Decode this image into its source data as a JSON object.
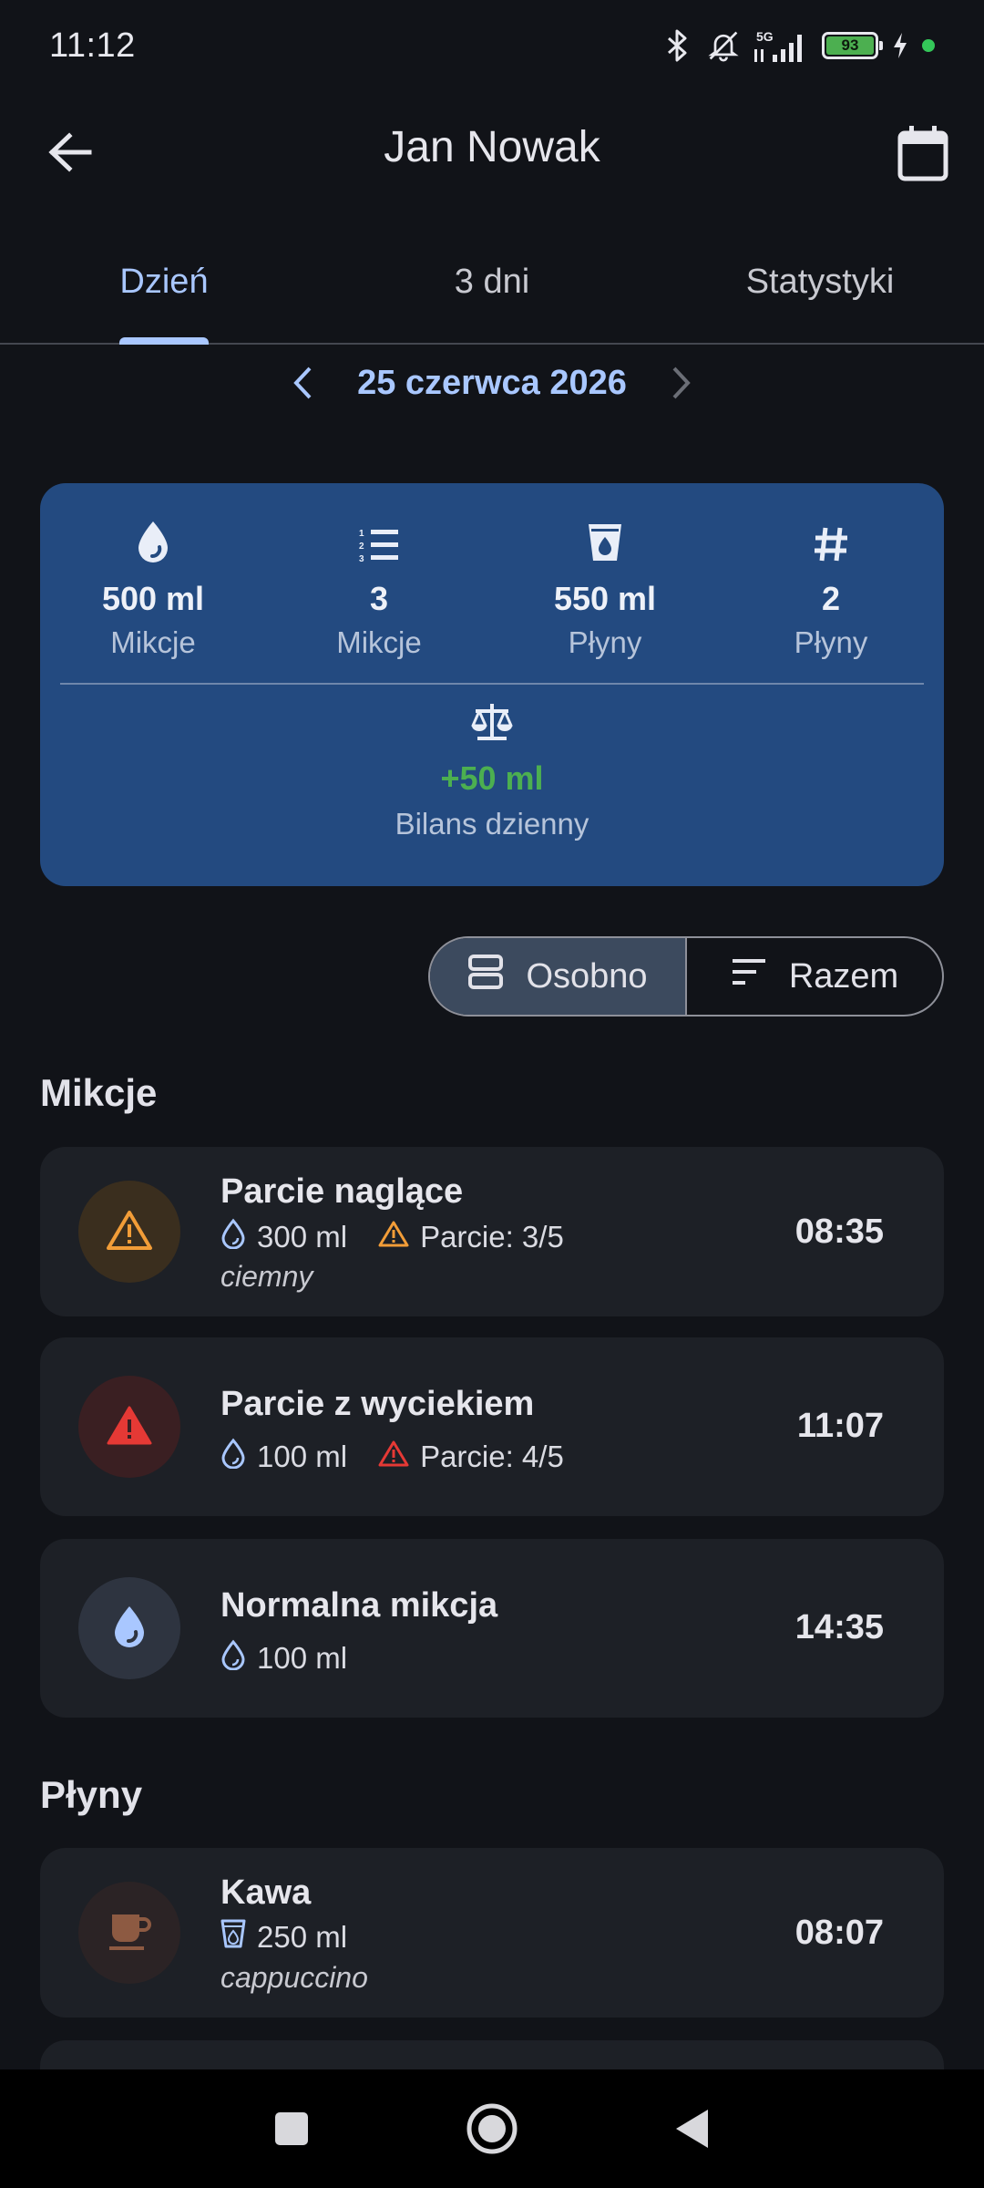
{
  "status": {
    "time": "11:12",
    "network": "5G",
    "battery": "93"
  },
  "appbar": {
    "title": "Jan Nowak"
  },
  "tabs": [
    {
      "label": "Dzień",
      "active": true
    },
    {
      "label": "3 dni",
      "active": false
    },
    {
      "label": "Statystyki",
      "active": false
    }
  ],
  "date_nav": {
    "date": "25 czerwca 2026"
  },
  "summary": {
    "stats": [
      {
        "icon": "drop-icon",
        "value": "500 ml",
        "label": "Mikcje"
      },
      {
        "icon": "numbered-list-icon",
        "value": "3",
        "label": "Mikcje"
      },
      {
        "icon": "cup-icon",
        "value": "550 ml",
        "label": "Płyny"
      },
      {
        "icon": "hash-icon",
        "value": "2",
        "label": "Płyny"
      }
    ],
    "balance": {
      "icon": "scale-icon",
      "value": "+50 ml",
      "label": "Bilans dzienny",
      "color": "#4caf50"
    }
  },
  "view_toggle": {
    "options": [
      {
        "label": "Osobno",
        "selected": true
      },
      {
        "label": "Razem",
        "selected": false
      }
    ]
  },
  "sections": {
    "mikcje": {
      "title": "Mikcje",
      "items": [
        {
          "name": "Parcie naglące",
          "volume": "300 ml",
          "urge": "Parcie: 3/5",
          "note": "ciemny",
          "time": "08:35",
          "icon": "warning-icon",
          "color": "#f29d38"
        },
        {
          "name": "Parcie z wyciekiem",
          "volume": "100 ml",
          "urge": "Parcie: 4/5",
          "time": "11:07",
          "icon": "warning-icon",
          "color": "#e53935"
        },
        {
          "name": "Normalna mikcja",
          "volume": "100 ml",
          "time": "14:35",
          "icon": "drop-icon",
          "color": "#a9c7ff"
        }
      ]
    },
    "plyny": {
      "title": "Płyny",
      "items": [
        {
          "name": "Kawa",
          "volume": "250 ml",
          "note": "cappuccino",
          "time": "08:07",
          "icon": "coffee-cup-icon",
          "color": "#8d5a42"
        }
      ]
    }
  }
}
